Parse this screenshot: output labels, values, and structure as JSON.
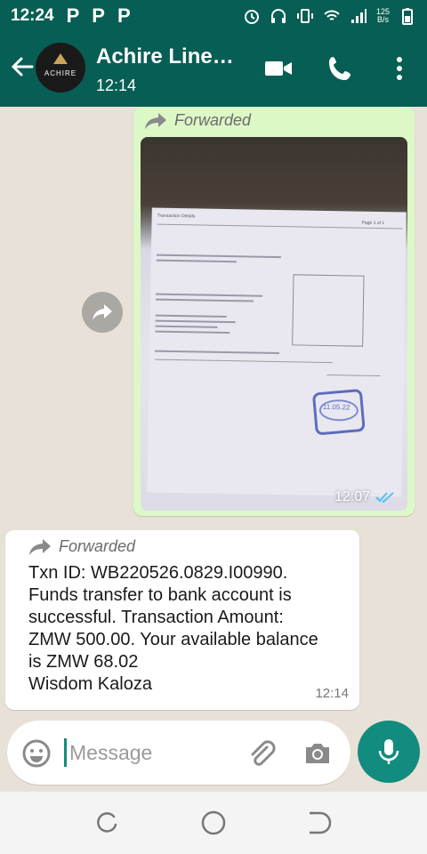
{
  "status_bar": {
    "time": "12:24",
    "notification_letters": [
      "P",
      "P",
      "P"
    ],
    "net_speed_value": "125",
    "net_speed_unit": "B/s",
    "icons": [
      "alarm-icon",
      "headset-icon",
      "vibrate-icon",
      "wifi-icon",
      "signal-icon",
      "battery-icon"
    ]
  },
  "header": {
    "contact_name": "Achire Line…",
    "subtitle": "12:14",
    "avatar_text": "ACHIRE"
  },
  "messages": {
    "image_message": {
      "forwarded_label": "Forwarded",
      "photo_header_left": "Transaction Details",
      "photo_header_right": "Page 1 of 1",
      "stamp_text": "11.05.22",
      "time": "12:07",
      "status": "read"
    },
    "text_message": {
      "forwarded_label": "Forwarded",
      "body": "Txn ID: WB220526.0829.I00990.\nFunds transfer to bank account is\nsuccessful. Transaction Amount:\nZMW 500.00. Your available balance\nis ZMW 68.02\nWisdom Kaloza",
      "time": "12:14"
    }
  },
  "composer": {
    "placeholder": "Message"
  },
  "colors": {
    "header_bg": "#075e54",
    "accent": "#128c7e",
    "outgoing_bubble": "#dcf8c6",
    "chat_bg": "#e8e1d7",
    "read_ticks": "#4fc3f7"
  }
}
